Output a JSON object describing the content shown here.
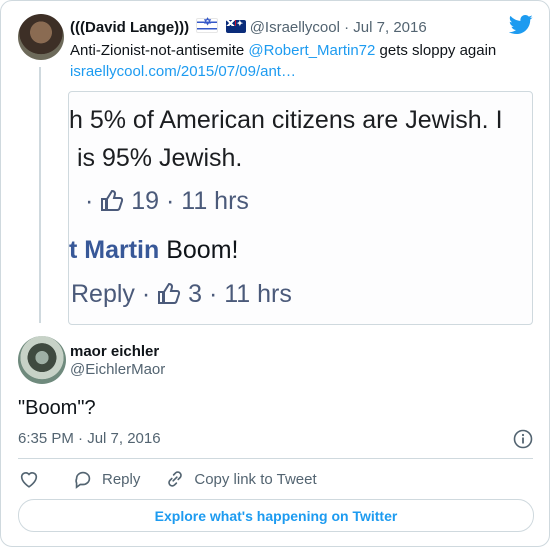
{
  "quoted_tweet": {
    "author_name": "(((David Lange)))",
    "handle": "@Israellycool",
    "date": "Jul 7, 2016",
    "text_prefix": "Anti-Zionist-not-antisemite ",
    "mention": "@Robert_Martin72",
    "text_suffix": " gets sloppy again",
    "link": "israellycool.com/2015/07/09/ant…",
    "flags": [
      "israel-flag",
      "australia-flag"
    ],
    "preview": {
      "line1": "h 5% of American citizens are Jewish. I",
      "line2": "is 95% Jewish.",
      "line3_count": "19",
      "line3_time": "· 11 hrs",
      "line4_name": "t Martin",
      "line4_text": " Boom!",
      "line5_reply": "Reply ·",
      "line5_count": "3",
      "line5_time": "· 11 hrs"
    }
  },
  "tweet": {
    "author_name": "maor eichler",
    "handle": "@EichlerMaor",
    "text": "\"Boom\"?",
    "timestamp": "6:35 PM · Jul 7, 2016"
  },
  "actions": {
    "reply_label": "Reply",
    "copy_label": "Copy link to Tweet"
  },
  "explore_label": "Explore what's happening on Twitter",
  "colors": {
    "accent": "#1d9bf0",
    "muted": "#536471",
    "border": "#cfd9de"
  }
}
